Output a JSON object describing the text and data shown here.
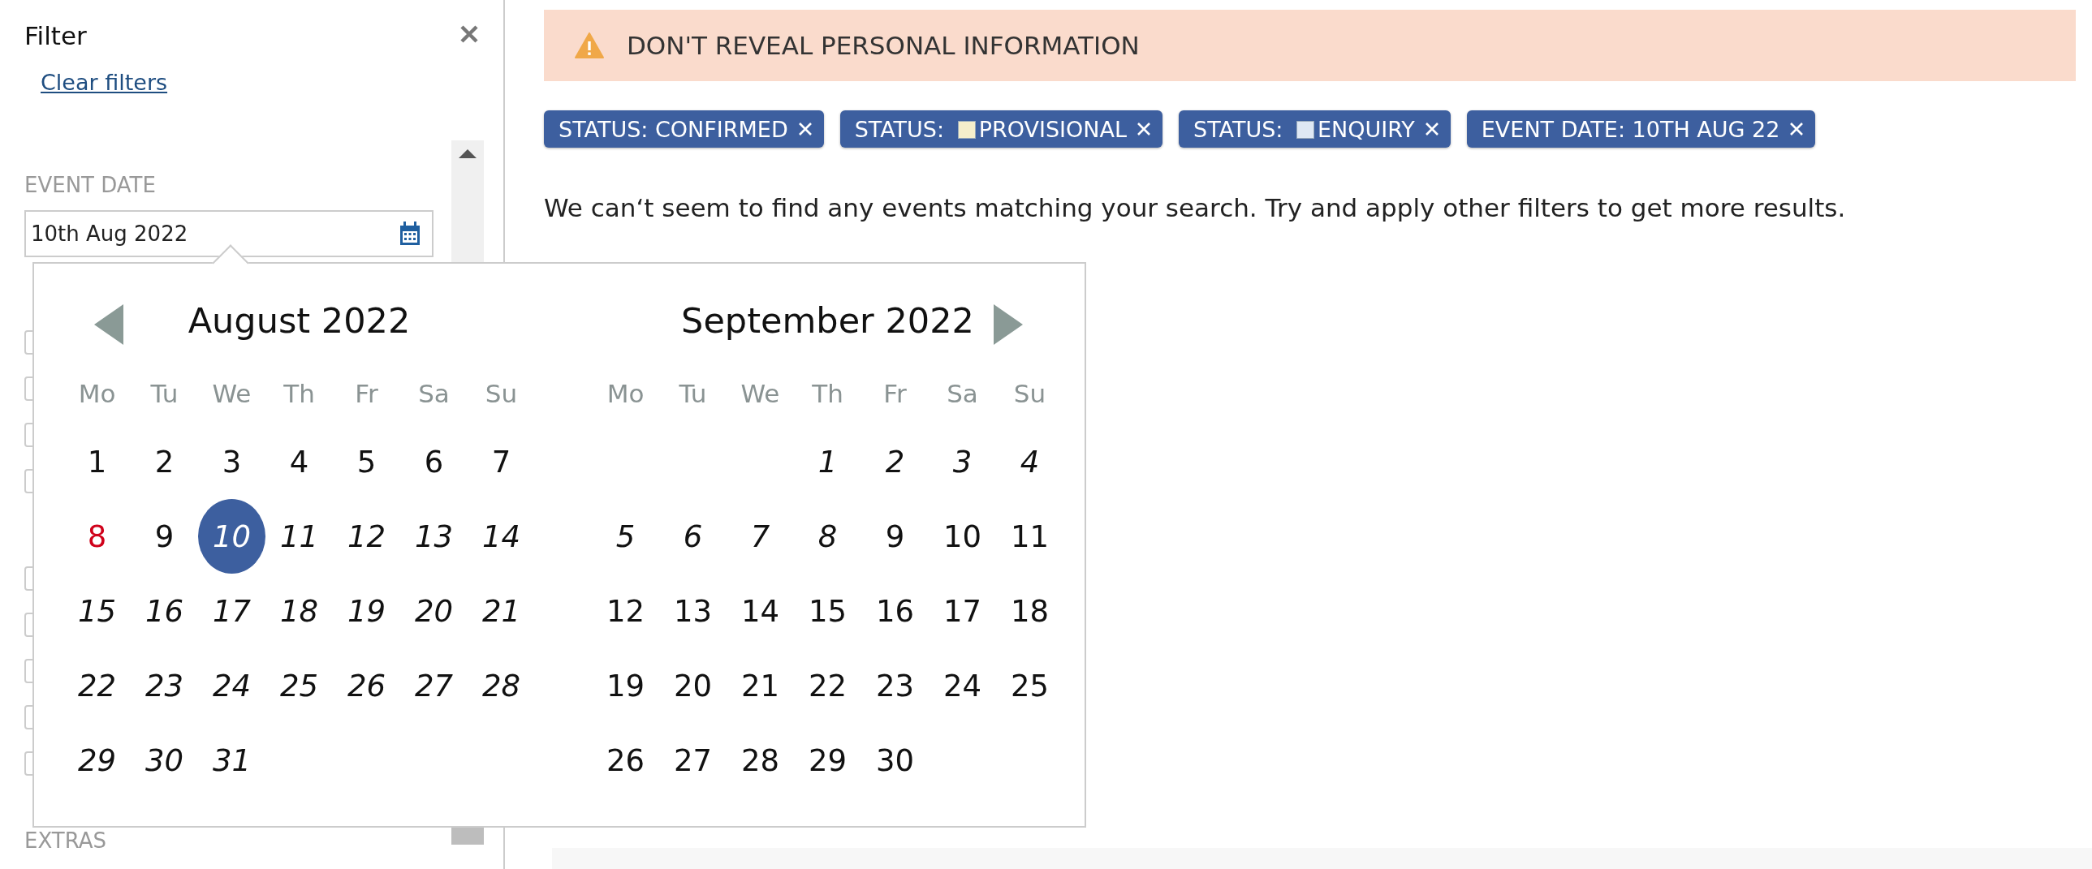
{
  "sidebar": {
    "title": "Filter",
    "clear_link": "Clear filters",
    "sections": [
      {
        "label": "EVENT DATE",
        "kind": "date",
        "value": "10th Aug 2022"
      },
      {
        "kind": "checks",
        "checkboxes": [
          {
            "checked": false
          },
          {
            "checked": false
          },
          {
            "checked": false
          },
          {
            "checked": false
          }
        ]
      },
      {
        "kind": "checks",
        "checkboxes": [
          {
            "checked": false
          },
          {
            "checked": false
          },
          {
            "checked": false
          },
          {
            "checked": false
          },
          {
            "checked": false
          }
        ]
      },
      {
        "label": "EXTRAS",
        "kind": "heading"
      }
    ]
  },
  "datepicker": {
    "months": [
      {
        "title": "August 2022",
        "weekdays": [
          "Mo",
          "Tu",
          "We",
          "Th",
          "Fr",
          "Sa",
          "Su"
        ],
        "weeks": [
          [
            {
              "label": "1",
              "kind": "plain",
              "selected": false
            },
            {
              "label": "2",
              "kind": "plain",
              "selected": false
            },
            {
              "label": "3",
              "kind": "plain",
              "selected": false
            },
            {
              "label": "4",
              "kind": "plain",
              "selected": false
            },
            {
              "label": "5",
              "kind": "plain",
              "selected": false
            },
            {
              "label": "6",
              "kind": "plain",
              "selected": false
            },
            {
              "label": "7",
              "kind": "plain",
              "selected": false
            }
          ],
          [
            {
              "label": "8",
              "kind": "today",
              "selected": false
            },
            {
              "label": "9",
              "kind": "plain",
              "selected": false
            },
            {
              "label": "10",
              "kind": "italic",
              "selected": true
            },
            {
              "label": "11",
              "kind": "italic",
              "selected": false
            },
            {
              "label": "12",
              "kind": "italic",
              "selected": false
            },
            {
              "label": "13",
              "kind": "italic",
              "selected": false
            },
            {
              "label": "14",
              "kind": "italic",
              "selected": false
            }
          ],
          [
            {
              "label": "15",
              "kind": "italic",
              "selected": false
            },
            {
              "label": "16",
              "kind": "italic",
              "selected": false
            },
            {
              "label": "17",
              "kind": "italic",
              "selected": false
            },
            {
              "label": "18",
              "kind": "italic",
              "selected": false
            },
            {
              "label": "19",
              "kind": "italic",
              "selected": false
            },
            {
              "label": "20",
              "kind": "italic",
              "selected": false
            },
            {
              "label": "21",
              "kind": "italic",
              "selected": false
            }
          ],
          [
            {
              "label": "22",
              "kind": "italic",
              "selected": false
            },
            {
              "label": "23",
              "kind": "italic",
              "selected": false
            },
            {
              "label": "24",
              "kind": "italic",
              "selected": false
            },
            {
              "label": "25",
              "kind": "italic",
              "selected": false
            },
            {
              "label": "26",
              "kind": "italic",
              "selected": false
            },
            {
              "label": "27",
              "kind": "italic",
              "selected": false
            },
            {
              "label": "28",
              "kind": "italic",
              "selected": false
            }
          ],
          [
            {
              "label": "29",
              "kind": "italic",
              "selected": false
            },
            {
              "label": "30",
              "kind": "italic",
              "selected": false
            },
            {
              "label": "31",
              "kind": "italic",
              "selected": false
            }
          ]
        ]
      },
      {
        "title": "September 2022",
        "weekdays": [
          "Mo",
          "Tu",
          "We",
          "Th",
          "Fr",
          "Sa",
          "Su"
        ],
        "weeks": [
          [
            {
              "kind": "blank"
            },
            {
              "kind": "blank"
            },
            {
              "kind": "blank"
            },
            {
              "label": "1",
              "kind": "italic",
              "selected": false
            },
            {
              "label": "2",
              "kind": "italic",
              "selected": false
            },
            {
              "label": "3",
              "kind": "italic",
              "selected": false
            },
            {
              "label": "4",
              "kind": "italic",
              "selected": false
            }
          ],
          [
            {
              "label": "5",
              "kind": "italic",
              "selected": false
            },
            {
              "label": "6",
              "kind": "italic",
              "selected": false
            },
            {
              "label": "7",
              "kind": "italic",
              "selected": false
            },
            {
              "label": "8",
              "kind": "italic",
              "selected": false
            },
            {
              "label": "9",
              "kind": "plain",
              "selected": false
            },
            {
              "label": "10",
              "kind": "plain",
              "selected": false
            },
            {
              "label": "11",
              "kind": "plain",
              "selected": false
            }
          ],
          [
            {
              "label": "12",
              "kind": "plain",
              "selected": false
            },
            {
              "label": "13",
              "kind": "plain",
              "selected": false
            },
            {
              "label": "14",
              "kind": "plain",
              "selected": false
            },
            {
              "label": "15",
              "kind": "plain",
              "selected": false
            },
            {
              "label": "16",
              "kind": "plain",
              "selected": false
            },
            {
              "label": "17",
              "kind": "plain",
              "selected": false
            },
            {
              "label": "18",
              "kind": "plain",
              "selected": false
            }
          ],
          [
            {
              "label": "19",
              "kind": "plain",
              "selected": false
            },
            {
              "label": "20",
              "kind": "plain",
              "selected": false
            },
            {
              "label": "21",
              "kind": "plain",
              "selected": false
            },
            {
              "label": "22",
              "kind": "plain",
              "selected": false
            },
            {
              "label": "23",
              "kind": "plain",
              "selected": false
            },
            {
              "label": "24",
              "kind": "plain",
              "selected": false
            },
            {
              "label": "25",
              "kind": "plain",
              "selected": false
            }
          ],
          [
            {
              "label": "26",
              "kind": "plain",
              "selected": false
            },
            {
              "label": "27",
              "kind": "plain",
              "selected": false
            },
            {
              "label": "28",
              "kind": "plain",
              "selected": false
            },
            {
              "label": "29",
              "kind": "plain",
              "selected": false
            },
            {
              "label": "30",
              "kind": "plain",
              "selected": false
            }
          ]
        ]
      }
    ]
  },
  "alert": {
    "text": "DON'T REVEAL PERSONAL INFORMATION"
  },
  "chips": [
    {
      "label": "STATUS:",
      "value": "CONFIRMED"
    },
    {
      "label": "STATUS:",
      "value": "PROVISIONAL",
      "color": "#f5eecb"
    },
    {
      "label": "STATUS:",
      "value": "ENQUIRY",
      "color": "#dfe8f4"
    },
    {
      "label": "EVENT DATE:",
      "value": "10TH AUG 22"
    }
  ],
  "message": "We can‘t seem to find any events matching your search. Try and apply other filters to get more results."
}
